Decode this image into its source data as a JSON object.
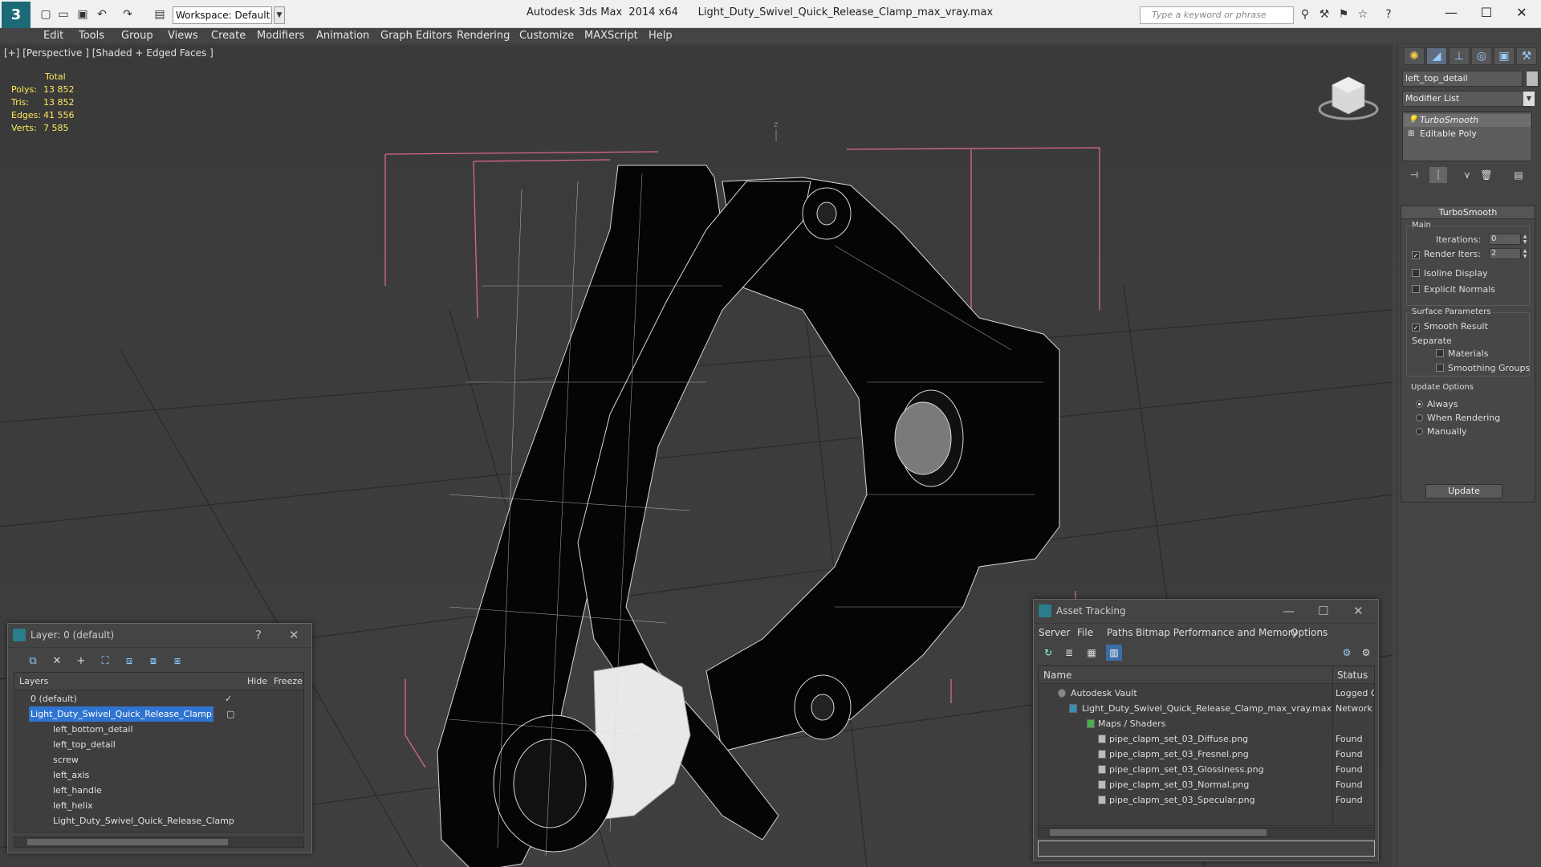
{
  "titlebar": {
    "workspace": "Workspace: Default",
    "app_title": "Autodesk 3ds Max  2014 x64      Light_Duty_Swivel_Quick_Release_Clamp_max_vray.max",
    "search_placeholder": "Type a keyword or phrase",
    "min_label": "—",
    "max_label": "☐",
    "close_label": "✕"
  },
  "menubar": [
    "Edit",
    "Tools",
    "Group",
    "Views",
    "Create",
    "Modifiers",
    "Animation",
    "Graph Editors",
    "Rendering",
    "Customize",
    "MAXScript",
    "Help"
  ],
  "viewport": {
    "label": "[+] [Perspective ] [Shaded + Edged Faces ]",
    "stats": {
      "header": "Total",
      "rows": [
        {
          "label": "Polys:",
          "value": "13 852"
        },
        {
          "label": "Tris:",
          "value": "13 852"
        },
        {
          "label": "Edges:",
          "value": "41 556"
        },
        {
          "label": "Verts:",
          "value": "7 585"
        }
      ]
    },
    "axis_label": "z"
  },
  "command_panel": {
    "object_name": "left_top_detail",
    "modifier_list": "Modifier List",
    "stack": [
      "TurboSmooth",
      "Editable Poly"
    ],
    "rollout": {
      "title": "TurboSmooth",
      "main_label": "Main",
      "iterations_label": "Iterations:",
      "iterations_value": "0",
      "render_iters_label": "Render Iters:",
      "render_iters_value": "2",
      "isoline_label": "Isoline Display",
      "explicit_normals_label": "Explicit Normals",
      "surface_params_label": "Surface Parameters",
      "smooth_result_label": "Smooth Result",
      "separate_label": "Separate",
      "materials_label": "Materials",
      "smoothing_groups_label": "Smoothing Groups",
      "update_options_label": "Update Options",
      "always_label": "Always",
      "when_rendering_label": "When Rendering",
      "manually_label": "Manually",
      "update_button": "Update"
    }
  },
  "layer_dialog": {
    "title": "Layer: 0 (default)",
    "help_label": "?",
    "close_label": "✕",
    "col_layers": "Layers",
    "col_hide": "Hide",
    "col_freeze": "Freeze",
    "rows": [
      {
        "name": "0 (default)",
        "indent": 1
      },
      {
        "name": "Light_Duty_Swivel_Quick_Release_Clamp",
        "indent": 1,
        "selected": true
      },
      {
        "name": "left_bottom_detail",
        "indent": 2
      },
      {
        "name": "left_top_detail",
        "indent": 2
      },
      {
        "name": "screw",
        "indent": 2
      },
      {
        "name": "left_axis",
        "indent": 2
      },
      {
        "name": "left_handle",
        "indent": 2
      },
      {
        "name": "left_helix",
        "indent": 2
      },
      {
        "name": "Light_Duty_Swivel_Quick_Release_Clamp",
        "indent": 2
      }
    ]
  },
  "asset_dialog": {
    "title": "Asset Tracking",
    "min_label": "—",
    "max_label": "☐",
    "close_label": "✕",
    "menu": [
      "Server",
      "File",
      "Paths",
      "Bitmap Performance and Memory",
      "Options"
    ],
    "col_name": "Name",
    "col_status": "Status",
    "rows": [
      {
        "name": "Autodesk Vault",
        "status": "Logged O",
        "indent": 1
      },
      {
        "name": "Light_Duty_Swivel_Quick_Release_Clamp_max_vray.max",
        "status": "Network P",
        "indent": 2
      },
      {
        "name": "Maps / Shaders",
        "status": "",
        "indent": 3
      },
      {
        "name": "pipe_clapm_set_03_Diffuse.png",
        "status": "Found",
        "indent": 4
      },
      {
        "name": "pipe_clapm_set_03_Fresnel.png",
        "status": "Found",
        "indent": 4
      },
      {
        "name": "pipe_clapm_set_03_Glossiness.png",
        "status": "Found",
        "indent": 4
      },
      {
        "name": "pipe_clapm_set_03_Normal.png",
        "status": "Found",
        "indent": 4
      },
      {
        "name": "pipe_clapm_set_03_Specular.png",
        "status": "Found",
        "indent": 4
      }
    ]
  }
}
